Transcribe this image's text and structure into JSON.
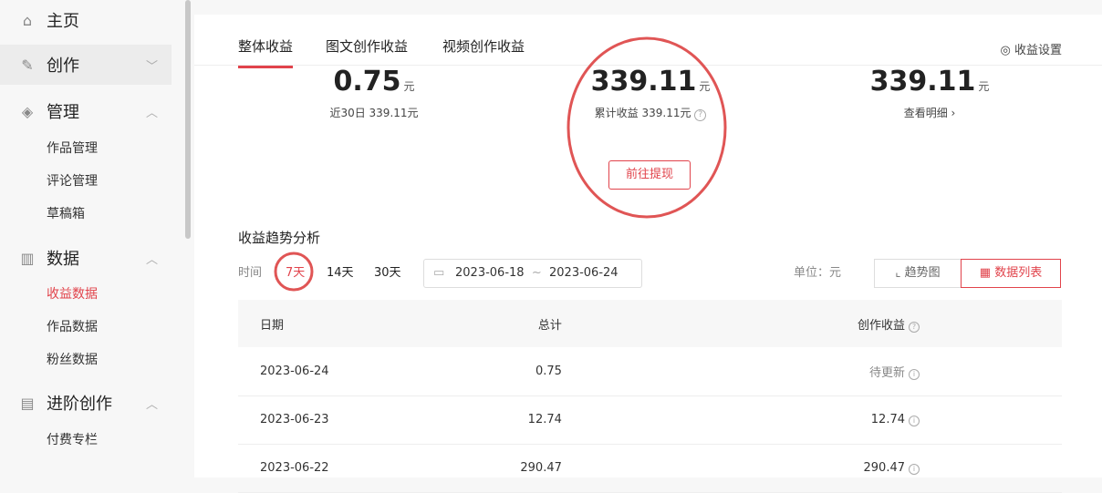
{
  "sidebar": {
    "home": "主页",
    "create": "创作",
    "manage": "管理",
    "manage_items": [
      "作品管理",
      "评论管理",
      "草稿箱"
    ],
    "data": "数据",
    "data_items": [
      "收益数据",
      "作品数据",
      "粉丝数据"
    ],
    "advanced": "进阶创作",
    "advanced_items": [
      "付费专栏"
    ]
  },
  "tabs": [
    "整体收益",
    "图文创作收益",
    "视频创作收益"
  ],
  "settings": "收益设置",
  "stats": [
    {
      "value": "0.75",
      "unit": "元",
      "sub": "近30日 339.11元"
    },
    {
      "value": "339.11",
      "unit": "元",
      "sub": "累计收益 339.11元",
      "button": "前往提现"
    },
    {
      "value": "339.11",
      "unit": "元",
      "sub": "查看明细 ›"
    }
  ],
  "trend": {
    "title": "收益趋势分析",
    "time_label": "时间",
    "ranges": [
      "7天",
      "14天",
      "30天"
    ],
    "start": "2023-06-18",
    "sep": "~",
    "end": "2023-06-24",
    "unit": "单位：元",
    "view_chart": "趋势图",
    "view_list": "数据列表"
  },
  "table": {
    "headers": [
      "日期",
      "总计",
      "创作收益"
    ],
    "rows": [
      {
        "date": "2023-06-24",
        "total": "0.75",
        "income": "待更新"
      },
      {
        "date": "2023-06-23",
        "total": "12.74",
        "income": "12.74"
      },
      {
        "date": "2023-06-22",
        "total": "290.47",
        "income": "290.47"
      }
    ]
  },
  "colors": {
    "accent": "#e1434b"
  }
}
